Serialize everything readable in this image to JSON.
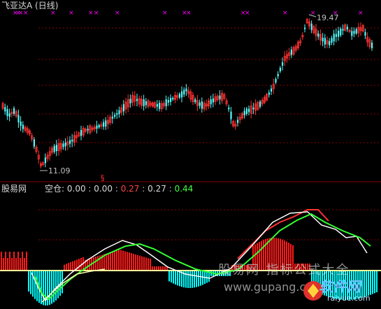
{
  "window": {
    "title": "飞亚达A (日线)"
  },
  "price_panel": {
    "high_marker": "19.47",
    "low_marker": "11.09",
    "signal_marker": "§",
    "colors": {
      "up": "#ff3232",
      "down": "#54fcfc",
      "grid": "#8b0000",
      "marker": "#ff00ff",
      "text": "#c0c0c0"
    }
  },
  "indicator_panel": {
    "name": "股易网",
    "label": "空仓:",
    "values": [
      {
        "text": "0.00",
        "color": "#d8d8d8"
      },
      {
        "text": "0.00",
        "color": "#d8d8d8"
      },
      {
        "text": "0.27",
        "color": "#ff4444"
      },
      {
        "text": "0.27",
        "color": "#d8d8d8"
      },
      {
        "text": "0.44",
        "color": "#44ff44"
      }
    ],
    "separator": ":",
    "colors": {
      "pos_bar": "#ff1a1a",
      "neg_bar": "#00ffff",
      "zero_line": "#ffff99",
      "fast_line": "#ffffff",
      "slow_line": "#33ff33",
      "signal_line": "#ff3333"
    }
  },
  "watermark": {
    "text": "股易网-指标公式大全",
    "url": "www.gupang.com",
    "badge": "软件网",
    "badge_sub": "raiyue.com"
  }
}
